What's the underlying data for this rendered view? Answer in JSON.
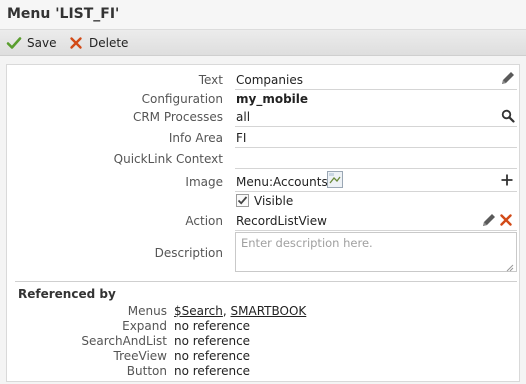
{
  "window": {
    "title": "Menu 'LIST_FI'"
  },
  "toolbar": {
    "save_label": "Save",
    "delete_label": "Delete"
  },
  "form": {
    "text": {
      "label": "Text",
      "value": "Companies"
    },
    "configuration": {
      "label": "Configuration",
      "value": "my_mobile"
    },
    "crm_processes": {
      "label": "CRM Processes",
      "value": "all"
    },
    "info_area": {
      "label": "Info Area",
      "value": "FI"
    },
    "quicklink": {
      "label": "QuickLink Context",
      "value": ""
    },
    "image": {
      "label": "Image",
      "value": "Menu:Accounts"
    },
    "visible": {
      "label": "Visible",
      "checked": true
    },
    "action": {
      "label": "Action",
      "value": "RecordListView"
    },
    "description": {
      "label": "Description",
      "placeholder": "Enter description here."
    }
  },
  "referenced_by": {
    "heading": "Referenced by",
    "menus": {
      "label": "Menus",
      "links": [
        "$Search",
        "SMARTBOOK"
      ],
      "separator": ", "
    },
    "expand": {
      "label": "Expand",
      "value": "no reference"
    },
    "search_and_list": {
      "label": "SearchAndList",
      "value": "no reference"
    },
    "tree_view": {
      "label": "TreeView",
      "value": "no reference"
    },
    "button": {
      "label": "Button",
      "value": "no reference"
    }
  },
  "icons": {
    "save": "checkmark-icon",
    "delete": "x-icon",
    "edit": "pencil-icon",
    "search": "magnifier-icon",
    "add": "plus-icon",
    "remove": "x-icon",
    "image": "broken-image-icon"
  },
  "colors": {
    "save_green": "#5a9e2f",
    "delete_orange": "#d24a17",
    "icon_gray": "#5a5a5a"
  }
}
